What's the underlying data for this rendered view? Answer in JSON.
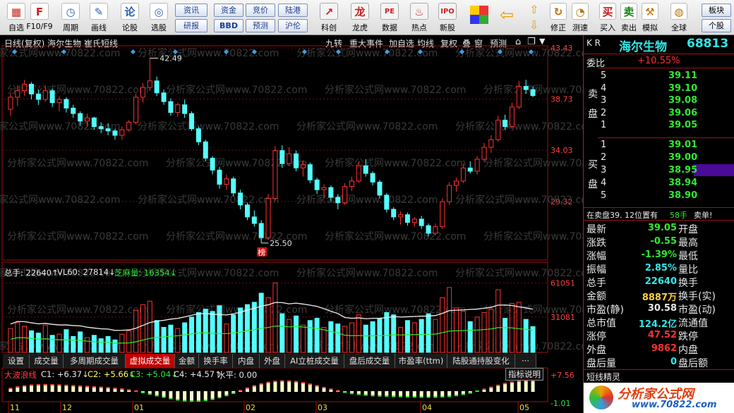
{
  "toolbar": {
    "items": [
      {
        "label": "自选",
        "icon": "grid-icon",
        "color": "#c8201a"
      },
      {
        "label": "F10/F9",
        "icon": "f10-icon",
        "color": "#d02020"
      },
      {
        "label": "周期",
        "icon": "clock-icon",
        "color": "#2a5fb8"
      },
      {
        "label": "画线",
        "icon": "pen-icon",
        "color": "#2a5fb8"
      },
      {
        "label": "论股",
        "icon": "chat-icon",
        "color": "#2a5fb8"
      },
      {
        "label": "选股",
        "icon": "target-icon",
        "color": "#2a5fb8"
      }
    ],
    "mid_buttons": [
      [
        "资讯",
        "资金",
        "竞价",
        "陆港"
      ],
      [
        "研报",
        "BBD",
        "预测",
        "沪伦"
      ]
    ],
    "items2": [
      {
        "label": "科创",
        "icon": "chart-up-icon"
      },
      {
        "label": "龙虎",
        "icon": "dragon-icon"
      },
      {
        "label": "数据",
        "icon": "pe-icon"
      },
      {
        "label": "热点",
        "icon": "hot-icon"
      },
      {
        "label": "新股",
        "icon": "ipo-icon"
      }
    ],
    "items3": [
      {
        "label": "修正",
        "icon": "fix-icon"
      },
      {
        "label": "测速",
        "icon": "speed-icon"
      },
      {
        "label": "买入",
        "icon": "buy-icon",
        "text": "买"
      },
      {
        "label": "卖出",
        "icon": "sell-icon",
        "text": "卖"
      },
      {
        "label": "模拟",
        "icon": "hammer-icon"
      },
      {
        "label": "全球",
        "icon": "globe-icon"
      }
    ],
    "right_buttons": [
      "板块",
      "个股"
    ]
  },
  "header": {
    "title": "日线(复权) 海尔生物 崔氏短线",
    "buttons": [
      "九转",
      "重大事件",
      "加自选",
      "均线",
      "复权",
      "叠",
      "窗",
      "预测"
    ]
  },
  "price_axis": [
    "43.43",
    "38.73",
    "34.03",
    "29.32"
  ],
  "annotations": {
    "high": "42.49",
    "low": "25.50",
    "tag": "榜"
  },
  "volume_header": {
    "a": "总手: 22640↑",
    "b": "VL60: 27814↓",
    "c": "芝麻量: 16354↓"
  },
  "volume_axis": [
    "61051",
    "31081"
  ],
  "tabs": [
    "设置",
    "成交量",
    "多周期成交量",
    "虚拟成交量",
    "金额",
    "换手率",
    "内盘",
    "外盘",
    "AI立桩成交量",
    "盘后成交量",
    "市盈率(ttm)",
    "陆股通持股变化",
    "···"
  ],
  "active_tab": "虚拟成交量",
  "indicator": {
    "name": "大波浪线",
    "c1": "C1: +6.37↓",
    "c2": "C2: +5.66↓",
    "c3": "C3: +5.04↓",
    "c4": "C4: +4.57↑",
    "water": "水平: 0.00",
    "help": "指标说明",
    "top": "+7.56",
    "bot": "-1.01"
  },
  "months": [
    "11",
    "12",
    "01",
    "02",
    "03",
    "04",
    "05"
  ],
  "watermark": "分析家公式网www.70822.com",
  "quote": {
    "kr": "K R",
    "name": "海尔生物",
    "code": "68813",
    "weibi_label": "委比",
    "weibi": "+10.55%",
    "sell_label": "卖盘",
    "buy_label": "买盘",
    "asks": [
      [
        "5",
        "39.11"
      ],
      [
        "4",
        "39.10"
      ],
      [
        "3",
        "39.08"
      ],
      [
        "2",
        "39.06"
      ],
      [
        "1",
        "39.05"
      ]
    ],
    "bids": [
      [
        "1",
        "39.01"
      ],
      [
        "2",
        "39.00"
      ],
      [
        "3",
        "38.95"
      ],
      [
        "4",
        "38.94"
      ],
      [
        "5",
        "38.90"
      ]
    ],
    "notice": "在卖盘39. 12位置有",
    "notice_qty": "58手",
    "notice_tail": "卖单!",
    "stats": [
      [
        "最新",
        "39.05",
        "开盘",
        ""
      ],
      [
        "涨跌",
        "-0.55",
        "最高",
        ""
      ],
      [
        "涨幅",
        "-1.39%",
        "最低",
        ""
      ],
      [
        "振幅",
        "2.85%",
        "量比",
        ""
      ],
      [
        "总手",
        "22640",
        "换手",
        ""
      ],
      [
        "金额",
        "8887万",
        "换手(实)",
        ""
      ],
      [
        "市盈(静)",
        "30.58",
        "市盈(动)",
        ""
      ],
      [
        "总市值",
        "124.2亿",
        "流通值",
        ""
      ],
      [
        "涨停",
        "47.52",
        "跌停",
        ""
      ],
      [
        "外盘",
        "9862",
        "内盘",
        ""
      ],
      [
        "盘后量",
        "0",
        "盘后额",
        ""
      ]
    ],
    "footer": "短线精灵",
    "logo_text": "分析家公式网",
    "logo_url": "www.70822.com"
  },
  "chart_data": {
    "type": "candlestick",
    "ylim": [
      24.0,
      43.43
    ],
    "ohlc": [
      [
        37.8,
        39.3,
        37.2,
        38.9
      ],
      [
        38.9,
        40.0,
        38.1,
        39.5
      ],
      [
        39.5,
        40.5,
        39.0,
        40.1
      ],
      [
        40.1,
        40.3,
        38.7,
        39.2
      ],
      [
        39.2,
        39.6,
        38.2,
        38.7
      ],
      [
        38.7,
        40.0,
        38.5,
        39.5
      ],
      [
        39.5,
        39.7,
        38.0,
        38.4
      ],
      [
        38.4,
        39.0,
        37.6,
        38.7
      ],
      [
        38.7,
        38.9,
        37.5,
        37.9
      ],
      [
        37.9,
        38.2,
        37.0,
        37.4
      ],
      [
        37.4,
        37.6,
        36.3,
        36.7
      ],
      [
        36.7,
        37.4,
        36.2,
        37.0
      ],
      [
        37.0,
        37.1,
        35.9,
        36.2
      ],
      [
        36.2,
        36.6,
        35.6,
        36.0
      ],
      [
        36.0,
        36.5,
        35.4,
        35.8
      ],
      [
        35.8,
        36.0,
        35.0,
        35.4
      ],
      [
        35.4,
        36.2,
        35.0,
        35.9
      ],
      [
        35.9,
        36.8,
        35.7,
        36.6
      ],
      [
        36.6,
        39.2,
        36.4,
        38.9
      ],
      [
        38.9,
        40.2,
        38.4,
        39.8
      ],
      [
        39.8,
        42.49,
        39.5,
        40.4
      ],
      [
        40.4,
        40.8,
        39.0,
        39.3
      ],
      [
        39.3,
        39.6,
        38.2,
        38.5
      ],
      [
        38.5,
        38.8,
        37.2,
        37.5
      ],
      [
        37.5,
        38.4,
        37.1,
        38.2
      ],
      [
        38.2,
        38.7,
        37.0,
        37.4
      ],
      [
        37.4,
        37.6,
        35.8,
        36.0
      ],
      [
        36.0,
        36.2,
        34.5,
        34.8
      ],
      [
        34.8,
        35.0,
        33.0,
        33.3
      ],
      [
        33.3,
        33.5,
        31.8,
        32.2
      ],
      [
        32.2,
        32.5,
        30.5,
        30.9
      ],
      [
        30.9,
        31.8,
        30.4,
        31.4
      ],
      [
        31.4,
        31.6,
        29.8,
        30.1
      ],
      [
        30.1,
        30.4,
        28.6,
        29.0
      ],
      [
        29.0,
        29.2,
        27.6,
        27.9
      ],
      [
        27.9,
        28.5,
        27.0,
        27.3
      ],
      [
        27.3,
        27.6,
        25.5,
        26.0
      ],
      [
        26.0,
        30.0,
        25.8,
        29.6
      ],
      [
        29.6,
        34.4,
        29.4,
        34.0
      ],
      [
        34.0,
        34.5,
        32.4,
        32.8
      ],
      [
        32.8,
        34.3,
        32.6,
        33.7
      ],
      [
        33.7,
        34.0,
        32.1,
        32.4
      ],
      [
        32.4,
        33.1,
        31.6,
        32.7
      ],
      [
        32.7,
        32.9,
        31.0,
        31.3
      ],
      [
        31.3,
        31.5,
        30.0,
        30.4
      ],
      [
        30.4,
        30.9,
        29.6,
        30.6
      ],
      [
        30.6,
        30.8,
        29.3,
        29.7
      ],
      [
        29.7,
        30.0,
        28.6,
        29.2
      ],
      [
        29.2,
        31.0,
        29.0,
        30.7
      ],
      [
        30.7,
        31.6,
        30.3,
        31.2
      ],
      [
        31.2,
        33.0,
        31.0,
        32.6
      ],
      [
        32.6,
        33.2,
        31.6,
        31.9
      ],
      [
        31.9,
        32.1,
        30.8,
        31.1
      ],
      [
        31.1,
        31.3,
        29.6,
        29.9
      ],
      [
        29.9,
        30.1,
        28.3,
        28.6
      ],
      [
        28.6,
        28.8,
        27.6,
        27.9
      ],
      [
        27.9,
        28.4,
        27.2,
        28.1
      ],
      [
        28.1,
        28.3,
        27.1,
        27.4
      ],
      [
        27.4,
        27.9,
        27.0,
        27.7
      ],
      [
        27.7,
        28.0,
        26.8,
        27.1
      ],
      [
        27.1,
        27.3,
        26.1,
        26.4
      ],
      [
        26.4,
        27.3,
        26.2,
        27.0
      ],
      [
        27.0,
        29.6,
        26.8,
        29.3
      ],
      [
        29.3,
        31.1,
        29.0,
        30.8
      ],
      [
        30.8,
        31.5,
        30.2,
        31.2
      ],
      [
        31.2,
        32.8,
        31.0,
        32.4
      ],
      [
        32.4,
        33.0,
        31.9,
        32.1
      ],
      [
        32.1,
        33.5,
        31.8,
        33.2
      ],
      [
        33.2,
        34.7,
        33.0,
        34.3
      ],
      [
        34.3,
        35.4,
        33.8,
        35.0
      ],
      [
        35.0,
        37.2,
        34.8,
        36.8
      ],
      [
        36.8,
        37.3,
        35.9,
        36.2
      ],
      [
        36.2,
        38.4,
        36.0,
        38.0
      ],
      [
        38.0,
        40.4,
        37.8,
        39.9
      ],
      [
        39.9,
        40.5,
        39.2,
        39.6
      ],
      [
        39.6,
        39.9,
        38.9,
        39.05
      ]
    ],
    "volume": [
      21000,
      26000,
      23000,
      19000,
      17000,
      24000,
      15000,
      16000,
      20000,
      14000,
      18000,
      13000,
      15000,
      12000,
      14000,
      11000,
      16000,
      19000,
      37000,
      42000,
      45000,
      28000,
      22000,
      24000,
      21000,
      26000,
      31000,
      35000,
      38000,
      36000,
      41000,
      25000,
      33000,
      39000,
      42000,
      44000,
      52000,
      48000,
      61051,
      34000,
      29000,
      32000,
      24000,
      28000,
      30000,
      22000,
      27000,
      25000,
      23000,
      26000,
      33000,
      24000,
      27000,
      30000,
      35000,
      33000,
      22000,
      28000,
      26000,
      29000,
      34000,
      29000,
      48000,
      57000,
      39000,
      36000,
      27000,
      31000,
      35000,
      38000,
      55000,
      30000,
      43000,
      44000,
      29000,
      22640
    ]
  }
}
